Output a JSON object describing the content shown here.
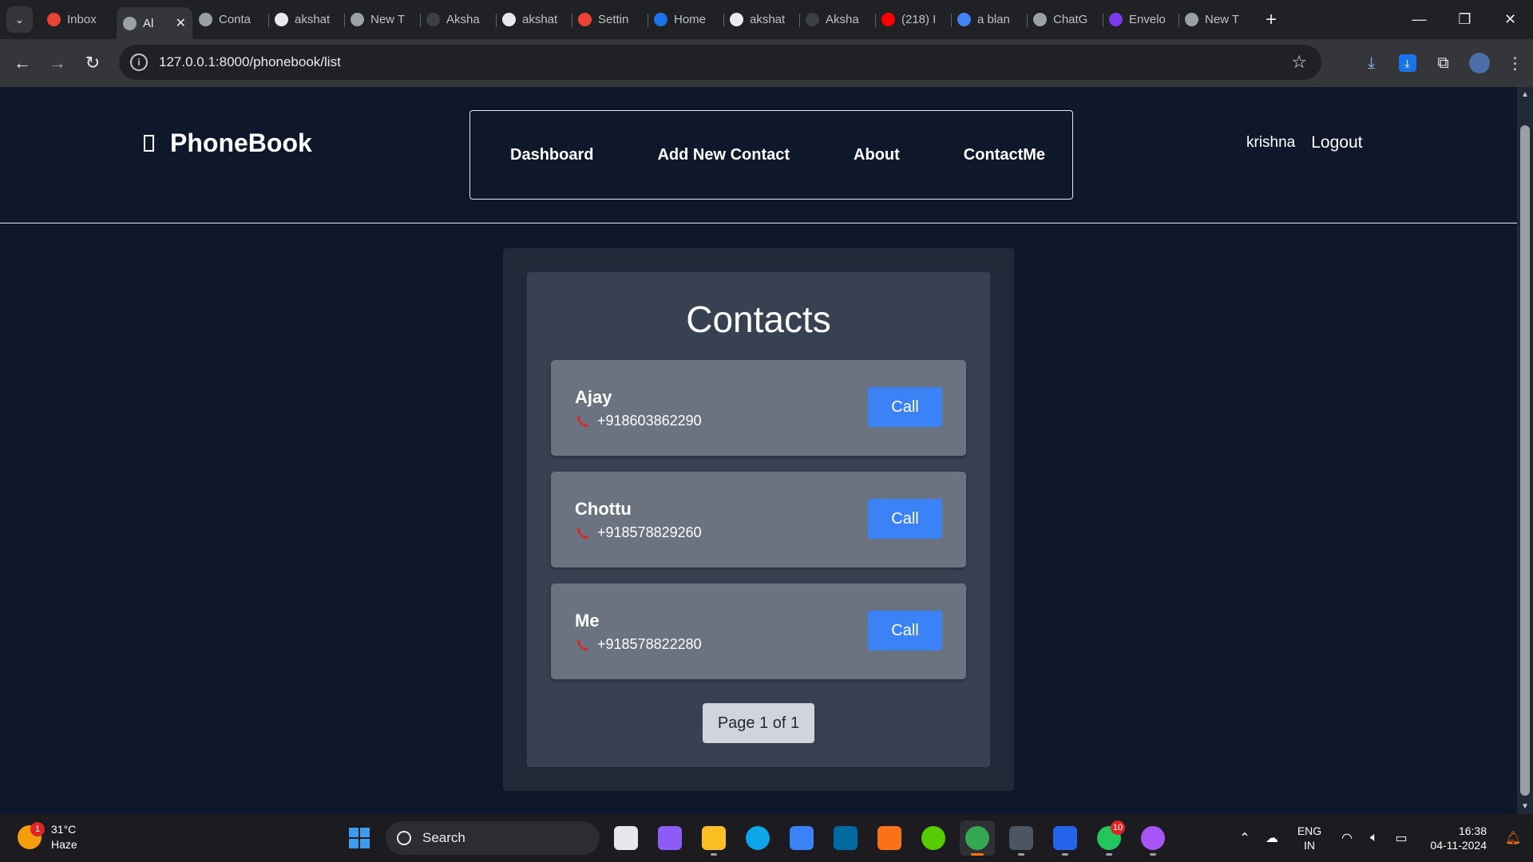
{
  "browser": {
    "tabs": [
      {
        "title": "Inbox",
        "favicon": "gmail-icon",
        "color": "#ea4335"
      },
      {
        "title": "Al",
        "favicon": "globe-icon",
        "color": "#9aa0a6",
        "active": true
      },
      {
        "title": "Conta",
        "favicon": "globe-icon",
        "color": "#9aa0a6"
      },
      {
        "title": "akshat",
        "favicon": "github-icon",
        "color": "#e8eaed"
      },
      {
        "title": "New T",
        "favicon": "chrome-icon",
        "color": "#9aa0a6"
      },
      {
        "title": "Aksha",
        "favicon": "medium-icon",
        "color": "#3c4043"
      },
      {
        "title": "akshat",
        "favicon": "github-icon",
        "color": "#e8eaed"
      },
      {
        "title": "Settin",
        "favicon": "gmail-icon",
        "color": "#ea4335"
      },
      {
        "title": "Home",
        "favicon": "canva-icon",
        "color": "#1a73e8"
      },
      {
        "title": "akshat",
        "favicon": "github-icon",
        "color": "#e8eaed"
      },
      {
        "title": "Aksha",
        "favicon": "medium-icon",
        "color": "#3c4043"
      },
      {
        "title": "(218) I",
        "favicon": "youtube-icon",
        "color": "#ff0000"
      },
      {
        "title": "a blan",
        "favicon": "google-icon",
        "color": "#4285f4"
      },
      {
        "title": "ChatG",
        "favicon": "chatgpt-icon",
        "color": "#9aa0a6"
      },
      {
        "title": "Envelo",
        "favicon": "b-icon",
        "color": "#7c3aed"
      },
      {
        "title": "New T",
        "favicon": "chrome-icon",
        "color": "#9aa0a6"
      }
    ],
    "url": "127.0.0.1:8000/phonebook/list"
  },
  "site": {
    "brand": "PhoneBook",
    "nav": [
      "Dashboard",
      "Add New Contact",
      "About",
      "ContactMe"
    ],
    "user": "krishna",
    "logout": "Logout"
  },
  "contacts": {
    "heading": "Contacts",
    "items": [
      {
        "name": "Ajay",
        "phone": "+918603862290",
        "call_label": "Call"
      },
      {
        "name": "Chottu",
        "phone": "+918578829260",
        "call_label": "Call"
      },
      {
        "name": "Me",
        "phone": "+918578822280",
        "call_label": "Call"
      }
    ],
    "pagination": "Page 1 of 1"
  },
  "taskbar": {
    "weather": {
      "temp": "31°C",
      "condition": "Haze",
      "badge": "1"
    },
    "search_placeholder": "Search",
    "apps": [
      {
        "name": "task-view",
        "color": "#e5e7eb"
      },
      {
        "name": "copilot",
        "color": "#8b5cf6"
      },
      {
        "name": "file-explorer",
        "color": "#fbbf24",
        "running": true
      },
      {
        "name": "edge",
        "color": "#0ea5e9"
      },
      {
        "name": "microsoft-store",
        "color": "#3b82f6"
      },
      {
        "name": "outlook",
        "color": "#0369a1"
      },
      {
        "name": "brave",
        "color": "#f97316"
      },
      {
        "name": "duolingo",
        "color": "#58cc02"
      },
      {
        "name": "chrome",
        "color": "#34a853",
        "running": true,
        "active": true
      },
      {
        "name": "terminal",
        "color": "#4b5563",
        "running": true
      },
      {
        "name": "vscode",
        "color": "#2563eb",
        "running": true
      },
      {
        "name": "whatsapp",
        "color": "#22c55e",
        "running": true,
        "badge": "10"
      },
      {
        "name": "chrome-profile",
        "color": "#a855f7",
        "running": true
      }
    ],
    "lang": [
      "ENG",
      "IN"
    ],
    "time": "16:38",
    "date": "04-11-2024"
  }
}
